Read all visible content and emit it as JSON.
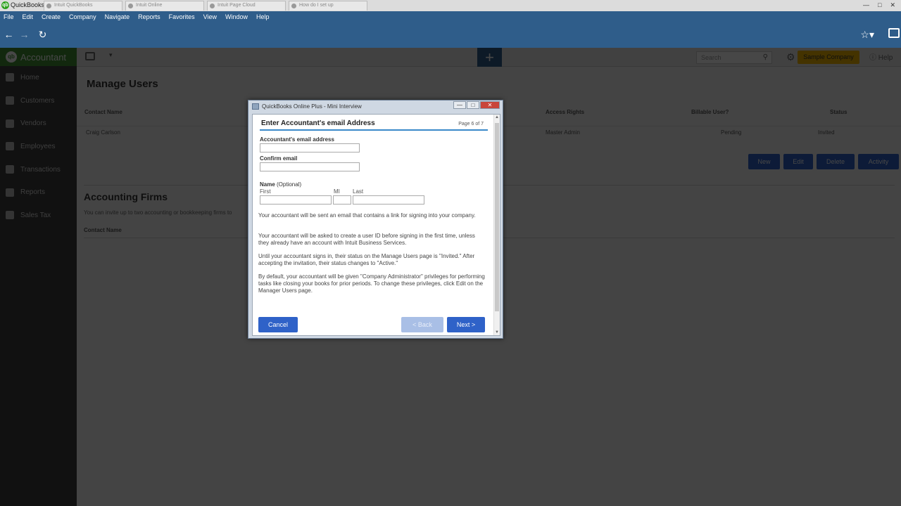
{
  "window": {
    "app_title": "QuickBooks",
    "browser_tabs": [
      "Intuit QuickBooks",
      "Intuit Online",
      "Intuit Page Cloud",
      "How do I set up"
    ],
    "controls": [
      "—",
      "□",
      "✕"
    ]
  },
  "menu": [
    "File",
    "Edit",
    "Create",
    "Company",
    "Navigate",
    "Reports",
    "Favorites",
    "View",
    "Window",
    "Help"
  ],
  "sidebar": {
    "brand": "Accountant",
    "items": [
      {
        "label": "Home"
      },
      {
        "label": "Customers"
      },
      {
        "label": "Vendors"
      },
      {
        "label": "Employees"
      },
      {
        "label": "Transactions"
      },
      {
        "label": "Reports"
      },
      {
        "label": "Sales Tax"
      }
    ]
  },
  "header": {
    "search_placeholder": "Search",
    "company_label": "Sample Company",
    "help_label": "Help"
  },
  "main": {
    "title": "Manage Users",
    "columns": [
      "Contact Name",
      "Access Rights",
      "Billable User?",
      "Status"
    ],
    "users": [
      {
        "name": "Craig Carlson",
        "access": "Master Admin",
        "billable": "Pending",
        "status": "Invited"
      }
    ],
    "buttons": [
      "New",
      "Edit",
      "Delete",
      "Activity"
    ],
    "firms_title": "Accounting Firms",
    "firms_subtitle": "You can invite up to two accounting or bookkeeping firms to",
    "firms_column": "Contact Name"
  },
  "dialog": {
    "title": "QuickBooks Online Plus - Mini Interview",
    "heading": "Enter Accountant's email Address",
    "page_indicator": "Page 6 of 7",
    "email_label": "Accountant's email address",
    "confirm_label": "Confirm email",
    "name_label": "Name",
    "name_optional": " (Optional)",
    "first_label": "First",
    "mi_label": "MI",
    "last_label": "Last",
    "paragraphs": [
      "Your accountant will be sent an email that contains a link for signing into your company.",
      "Your accountant will be asked to create a user ID before signing in the first time, unless they already have an account with Intuit Business Services.",
      "Until your accountant signs in, their status on the Manage Users page is \"Invited.\" After accepting the invitation, their status changes to \"Active.\"",
      "By default, your accountant will be given \"Company Administrator\" privileges for performing tasks like closing your books for prior periods. To change these privileges, click Edit on the Manager Users page."
    ],
    "cancel_label": "Cancel",
    "back_label": "< Back",
    "next_label": "Next >"
  },
  "icons": [
    "qb-logo-icon",
    "back-icon",
    "forward-icon",
    "refresh-icon",
    "star-icon",
    "chat-icon",
    "inbox-icon",
    "plus-icon",
    "search-icon",
    "gear-icon",
    "help-icon"
  ],
  "colors": {
    "nav_blue": "#2f5d8a",
    "brand_green": "#3f8f33",
    "button_blue": "#2f62c8",
    "company_yellow": "#f2b600"
  }
}
